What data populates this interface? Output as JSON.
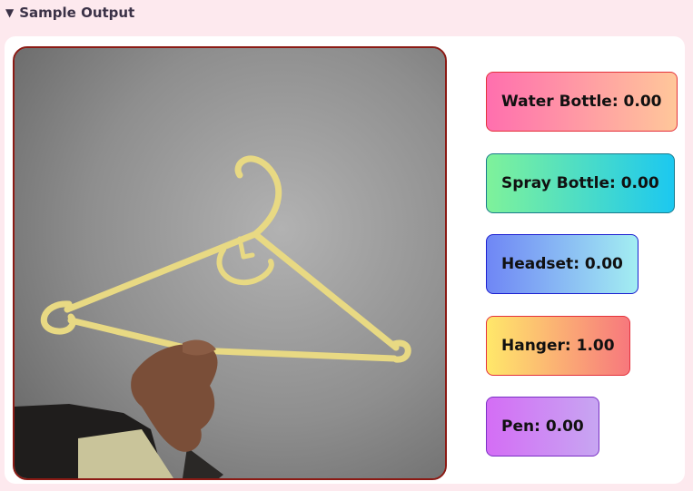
{
  "details": {
    "summary_label": "Sample Output",
    "expanded": true
  },
  "icons": {
    "toggle": "triangle-down-icon"
  },
  "predictions": [
    {
      "label": "Water Bottle",
      "score": "0.00"
    },
    {
      "label": "Spray Bottle",
      "score": "0.00"
    },
    {
      "label": "Headset",
      "score": "0.00"
    },
    {
      "label": "Hanger",
      "score": "1.00"
    },
    {
      "label": "Pen",
      "score": "0.00"
    }
  ],
  "colors": {
    "page_background": "#fde9ee",
    "camera_border": "#8b1a14"
  }
}
